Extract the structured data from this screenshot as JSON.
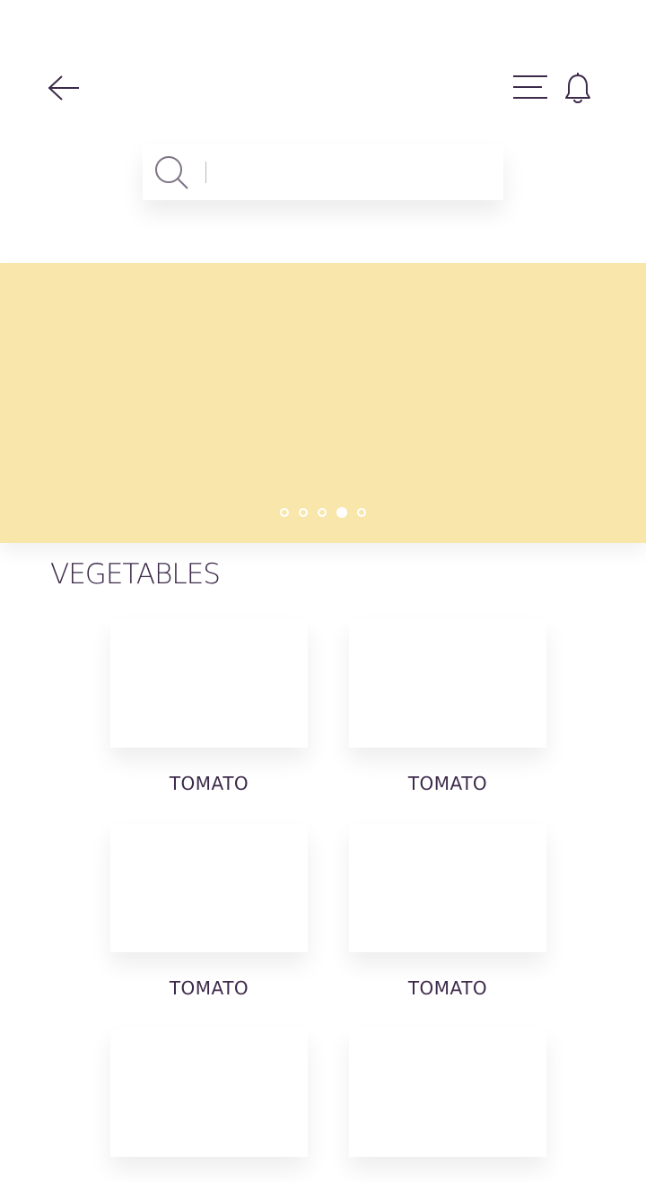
{
  "header": {
    "back_icon": "arrow-left-icon",
    "menu_icon": "menu-icon",
    "notification_icon": "bell-icon"
  },
  "search": {
    "icon": "search-icon",
    "value": "",
    "placeholder": ""
  },
  "banner": {
    "color": "#f9e6ab",
    "slides": 5,
    "active_slide": 4
  },
  "section": {
    "title": "VEGETABLES"
  },
  "products": [
    {
      "name": "TOMATO"
    },
    {
      "name": "TOMATO"
    },
    {
      "name": "TOMATO"
    },
    {
      "name": "TOMATO"
    },
    {
      "name": ""
    },
    {
      "name": ""
    }
  ],
  "colors": {
    "text": "#3d2a4a",
    "banner": "#f9e6ab",
    "background": "#ffffff"
  }
}
